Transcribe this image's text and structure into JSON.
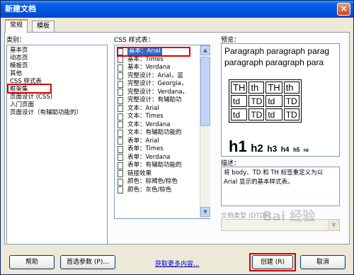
{
  "window": {
    "title": "新建文档",
    "close": "×"
  },
  "tabs": [
    {
      "label": "常规"
    },
    {
      "label": "模板"
    }
  ],
  "category": {
    "label": "类别：",
    "items": [
      "基本页",
      "动态页",
      "模板页",
      "其他",
      "CSS 样式表",
      "框架集",
      "页面设计 (CSS)",
      "入门页面",
      "页面设计（有辅助功能的）"
    ],
    "selected_index": 4
  },
  "styles": {
    "label": "CSS 样式表：",
    "items": [
      "基本：Arial",
      "基本：Times",
      "基本：Verdana",
      "完整设计：Arial，蓝",
      "完整设计：Georgia，",
      "完整设计：Verdana，",
      "完整设计：有辅助功",
      "文本：Arial",
      "文本：Times",
      "文本：Verdana",
      "文本：有辅助功能的",
      "表单：Arial",
      "表单：Times",
      "表单：Verdana",
      "表单：有辅助功能的",
      "链接效果",
      "颜色：棕褐色/棕色",
      "颜色：灰色/棕色"
    ],
    "selected_index": 0
  },
  "preview": {
    "label": "预览：",
    "paragraph_lines": [
      "Paragraph paragraph parag",
      "paragraph paragraph para"
    ],
    "table": [
      [
        "TH",
        "th",
        "TH",
        "th"
      ],
      [
        "td",
        "TD",
        "td",
        "TD"
      ],
      [
        "td",
        "TD",
        "td",
        "TD"
      ]
    ],
    "headings": [
      "h1",
      "h2",
      "h3",
      "h4",
      "h5",
      "h6"
    ]
  },
  "description": {
    "label": "描述：",
    "text": "将 body、TD 和 TH 标签重定义为以 Arial 显示的基本样式表。"
  },
  "doctype": {
    "label": "文档类型 (DTD)：",
    "value": ""
  },
  "footer": {
    "help": "帮助",
    "prefs": "首选参数 (P)...",
    "more": "获取更多内容...",
    "create": "创建 (R)",
    "cancel": "取消"
  },
  "watermark": "Bai 经验",
  "colors": {
    "selection": "#316ac5",
    "annotation": "#d90000",
    "titlebar": "#0054e3"
  }
}
